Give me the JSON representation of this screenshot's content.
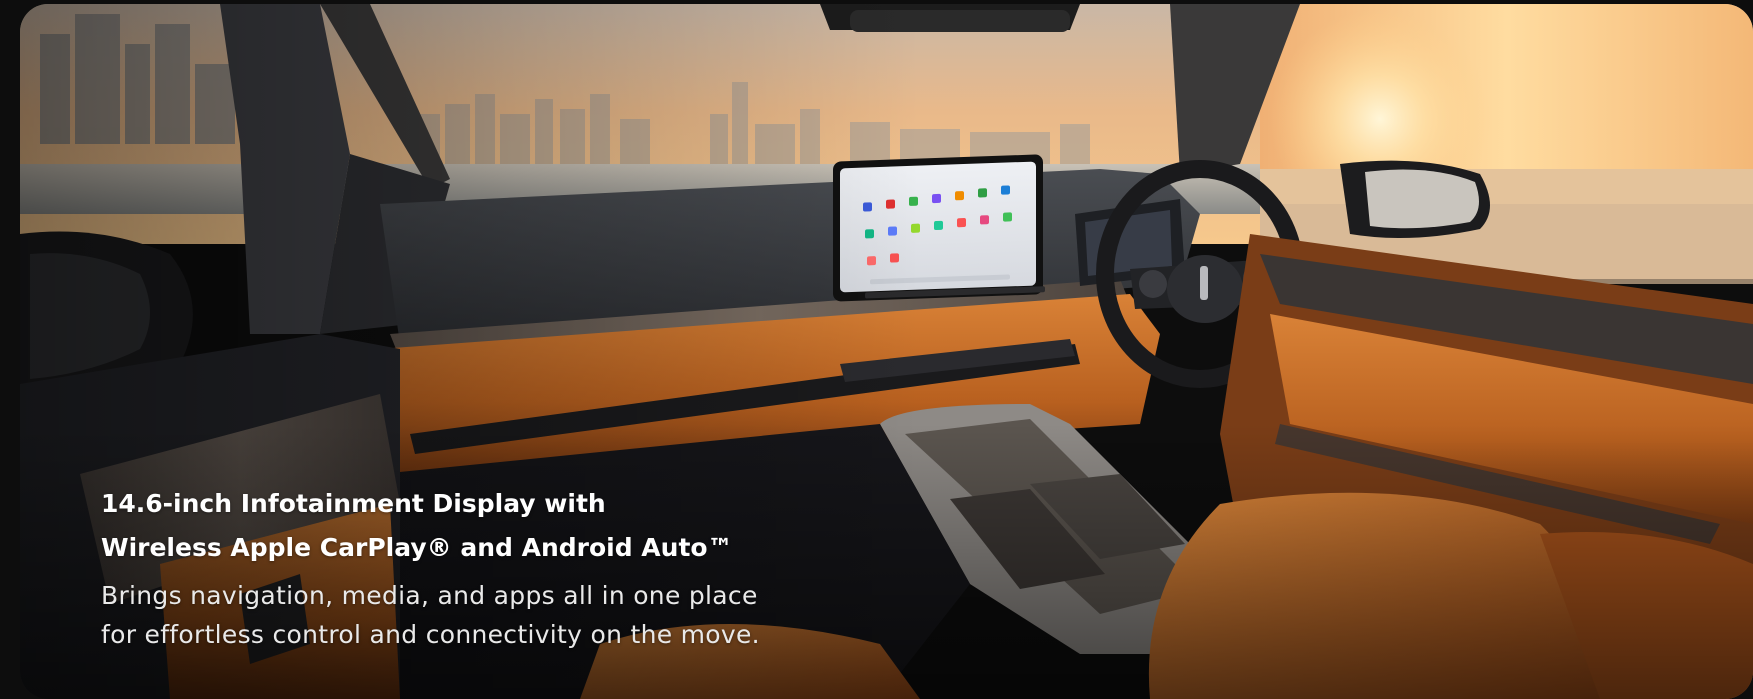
{
  "feature_card": {
    "headline_line1": "14.6-inch Infotainment Display with",
    "headline_line2": "Wireless Apple CarPlay® and Android Auto™",
    "description_line1": "Brings navigation, media, and apps all in one place",
    "description_line2": "for effortless control and connectivity on the move."
  },
  "colors": {
    "page_background": "#0d0d0d",
    "headline_text": "#ffffff",
    "description_text": "#e9e9e9",
    "leather_accent": "#c8702a",
    "sky_sunset": "#f3b56b"
  }
}
